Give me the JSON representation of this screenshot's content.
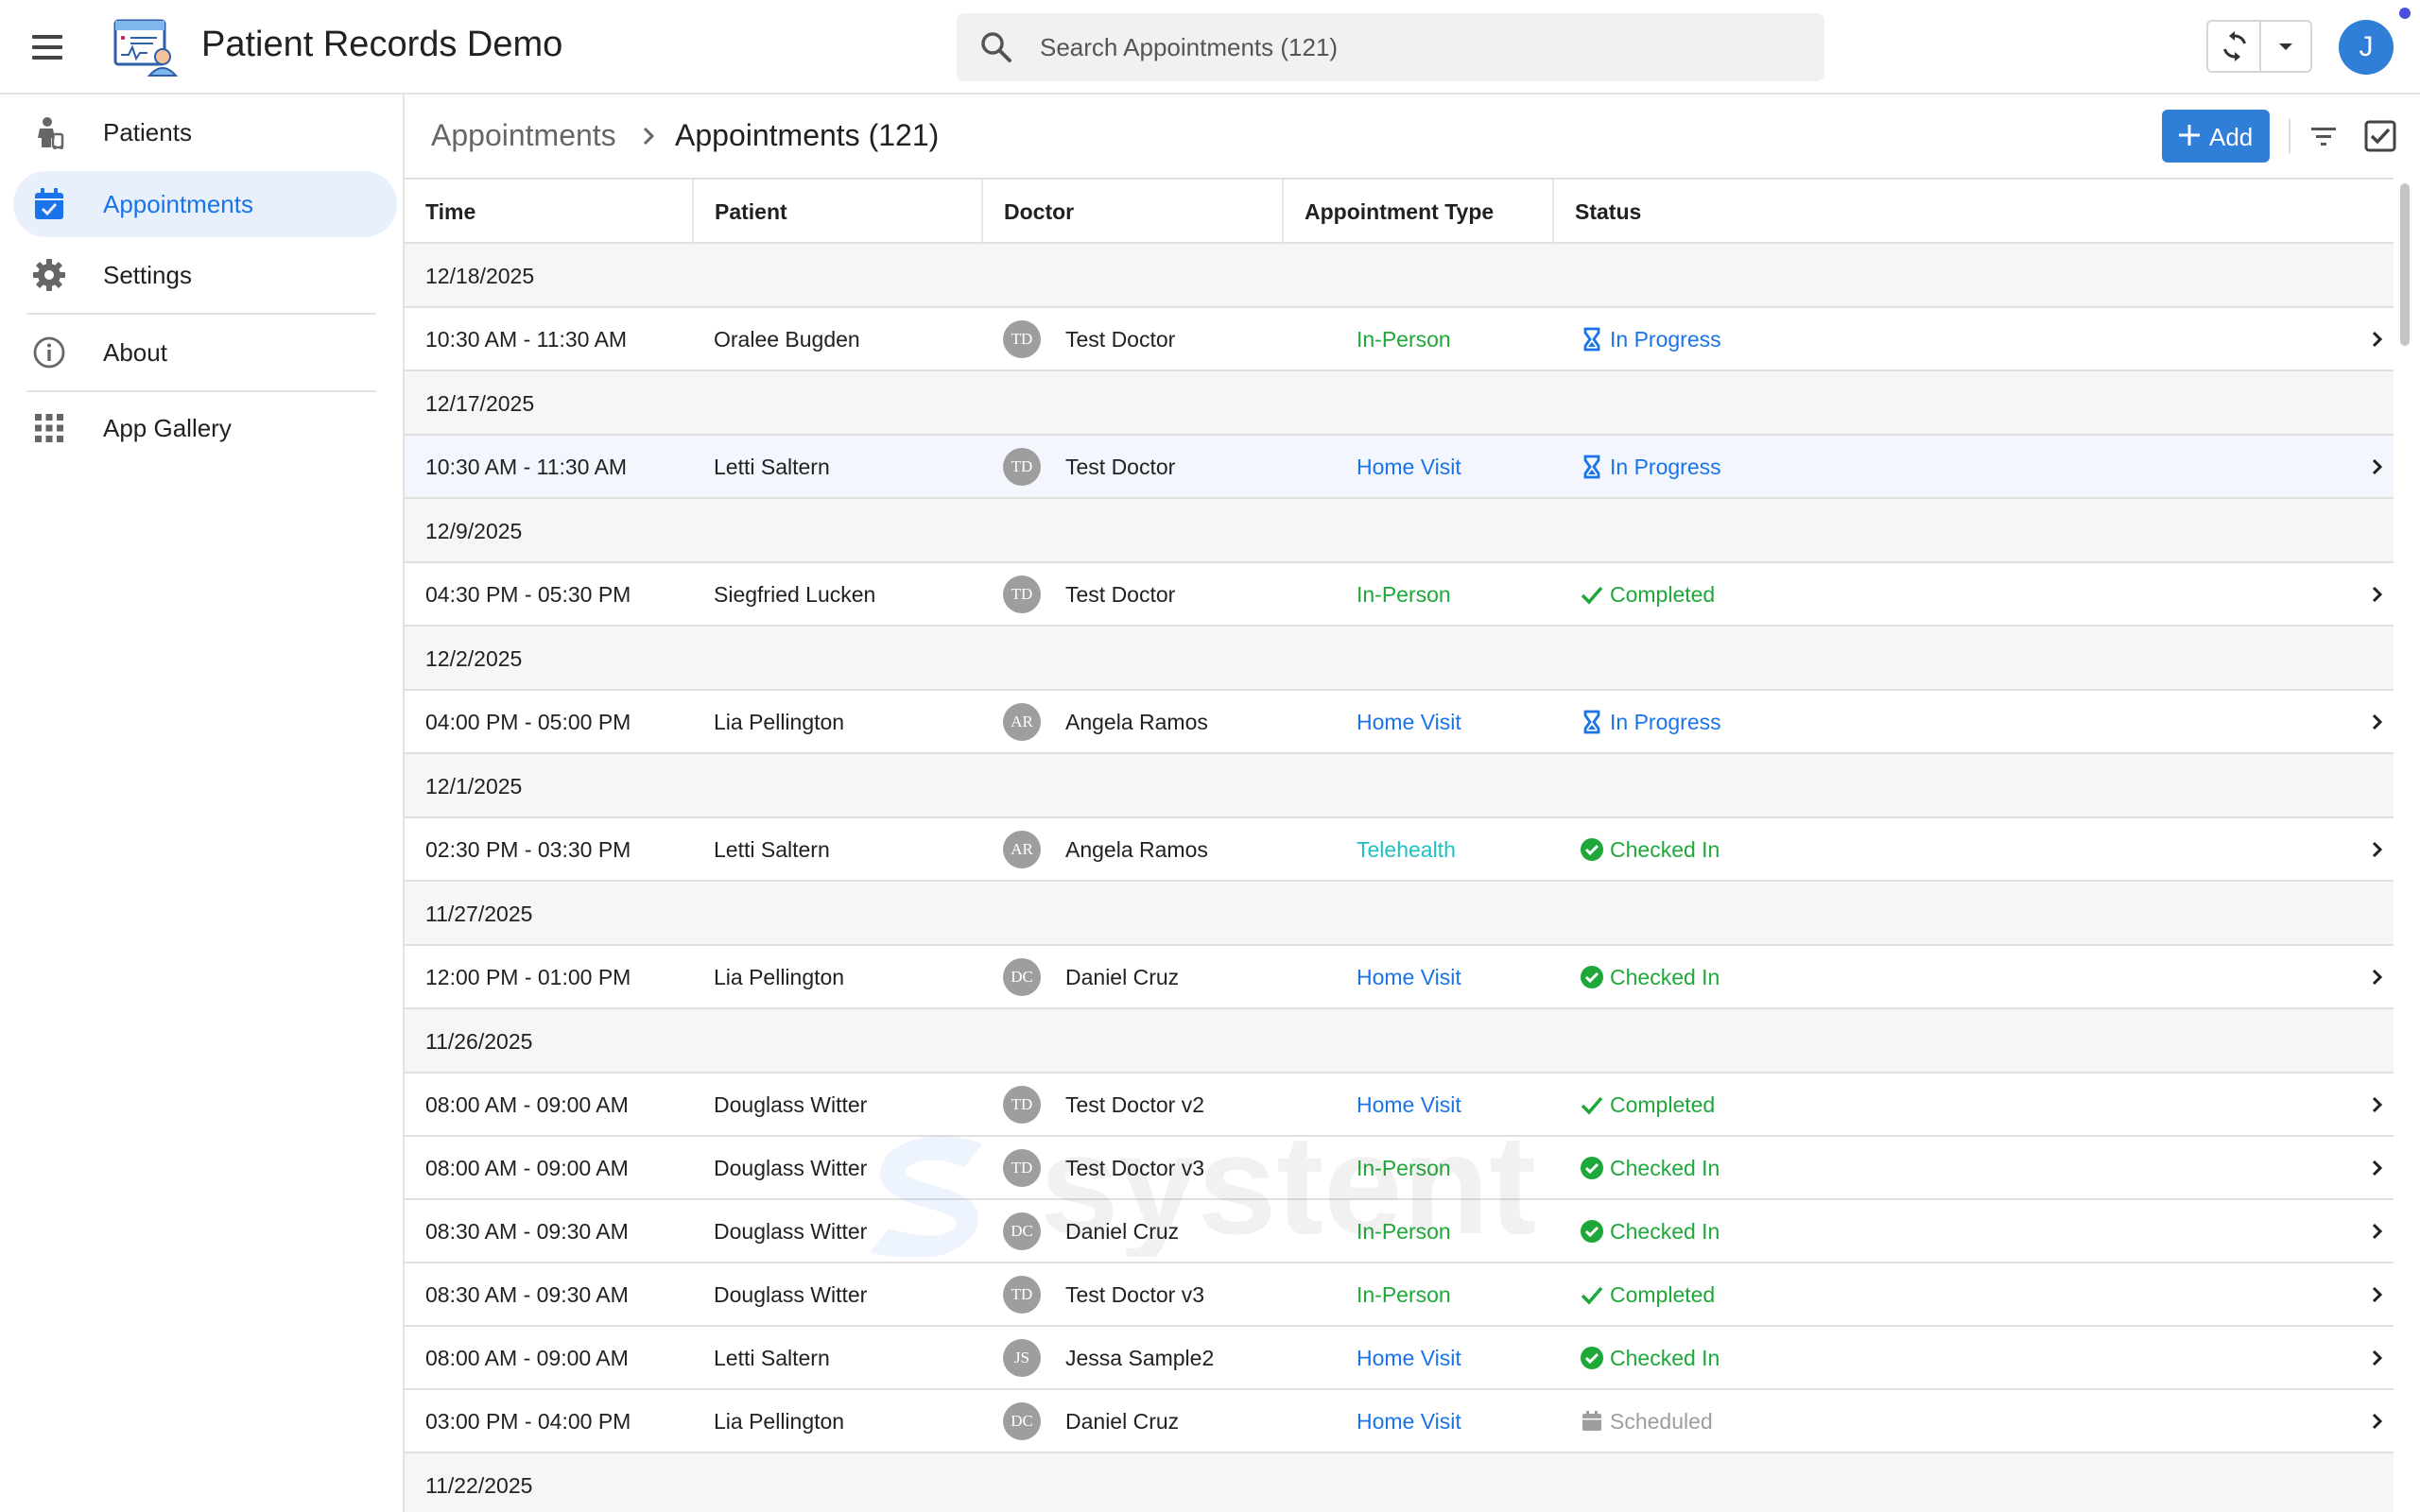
{
  "app": {
    "title": "Patient Records Demo",
    "user_initial": "J"
  },
  "search": {
    "placeholder": "Search Appointments (121)"
  },
  "sidebar": {
    "items": [
      {
        "label": "Patients",
        "icon": "patient-icon"
      },
      {
        "label": "Appointments",
        "icon": "calendar-check-icon",
        "active": true
      },
      {
        "label": "Settings",
        "icon": "gear-icon"
      },
      {
        "label": "About",
        "icon": "info-icon"
      },
      {
        "label": "App Gallery",
        "icon": "grid-icon"
      }
    ]
  },
  "breadcrumb": {
    "parent": "Appointments",
    "current": "Appointments (121)"
  },
  "toolbar": {
    "add_label": "Add"
  },
  "table": {
    "columns": [
      "Time",
      "Patient",
      "Doctor",
      "Appointment Type",
      "Status"
    ],
    "groups": [
      {
        "date": "12/18/2025",
        "rows": [
          {
            "time": "10:30 AM - 11:30 AM",
            "patient": "Oralee Bugden",
            "doctor_initials": "TD",
            "doctor": "Test Doctor",
            "type": "In-Person",
            "status": "In Progress"
          }
        ]
      },
      {
        "date": "12/17/2025",
        "rows": [
          {
            "time": "10:30 AM - 11:30 AM",
            "patient": "Letti Saltern",
            "doctor_initials": "TD",
            "doctor": "Test Doctor",
            "type": "Home Visit",
            "status": "In Progress"
          }
        ]
      },
      {
        "date": "12/9/2025",
        "rows": [
          {
            "time": "04:30 PM - 05:30 PM",
            "patient": "Siegfried Lucken",
            "doctor_initials": "TD",
            "doctor": "Test Doctor",
            "type": "In-Person",
            "status": "Completed"
          }
        ]
      },
      {
        "date": "12/2/2025",
        "rows": [
          {
            "time": "04:00 PM - 05:00 PM",
            "patient": "Lia Pellington",
            "doctor_initials": "AR",
            "doctor": "Angela Ramos",
            "type": "Home Visit",
            "status": "In Progress"
          }
        ]
      },
      {
        "date": "12/1/2025",
        "rows": [
          {
            "time": "02:30 PM - 03:30 PM",
            "patient": "Letti Saltern",
            "doctor_initials": "AR",
            "doctor": "Angela Ramos",
            "type": "Telehealth",
            "status": "Checked In"
          }
        ]
      },
      {
        "date": "11/27/2025",
        "rows": [
          {
            "time": "12:00 PM - 01:00 PM",
            "patient": "Lia Pellington",
            "doctor_initials": "DC",
            "doctor": "Daniel Cruz",
            "type": "Home Visit",
            "status": "Checked In"
          }
        ]
      },
      {
        "date": "11/26/2025",
        "rows": [
          {
            "time": "08:00 AM - 09:00 AM",
            "patient": "Douglass Witter",
            "doctor_initials": "TD",
            "doctor": "Test Doctor v2",
            "type": "Home Visit",
            "status": "Completed"
          },
          {
            "time": "08:00 AM - 09:00 AM",
            "patient": "Douglass Witter",
            "doctor_initials": "TD",
            "doctor": "Test Doctor v3",
            "type": "In-Person",
            "status": "Checked In"
          },
          {
            "time": "08:30 AM - 09:30 AM",
            "patient": "Douglass Witter",
            "doctor_initials": "DC",
            "doctor": "Daniel Cruz",
            "type": "In-Person",
            "status": "Checked In"
          },
          {
            "time": "08:30 AM - 09:30 AM",
            "patient": "Douglass Witter",
            "doctor_initials": "TD",
            "doctor": "Test Doctor v3",
            "type": "In-Person",
            "status": "Completed"
          },
          {
            "time": "08:00 AM - 09:00 AM",
            "patient": "Letti Saltern",
            "doctor_initials": "JS",
            "doctor": "Jessa Sample2",
            "type": "Home Visit",
            "status": "Checked In"
          },
          {
            "time": "03:00 PM - 04:00 PM",
            "patient": "Lia Pellington",
            "doctor_initials": "DC",
            "doctor": "Daniel Cruz",
            "type": "Home Visit",
            "status": "Scheduled"
          }
        ]
      },
      {
        "date": "11/22/2025",
        "rows": []
      }
    ]
  },
  "colors": {
    "accent": "#2f7fd8",
    "type_in_person": "#1fa83a",
    "type_home_visit": "#1a73e8",
    "type_telehealth": "#1ec1c1",
    "status_in_progress": "#1a73e8",
    "status_completed": "#1fa83a",
    "status_checked_in": "#1fa83a",
    "status_scheduled": "#9e9e9e"
  },
  "watermark": "systent"
}
